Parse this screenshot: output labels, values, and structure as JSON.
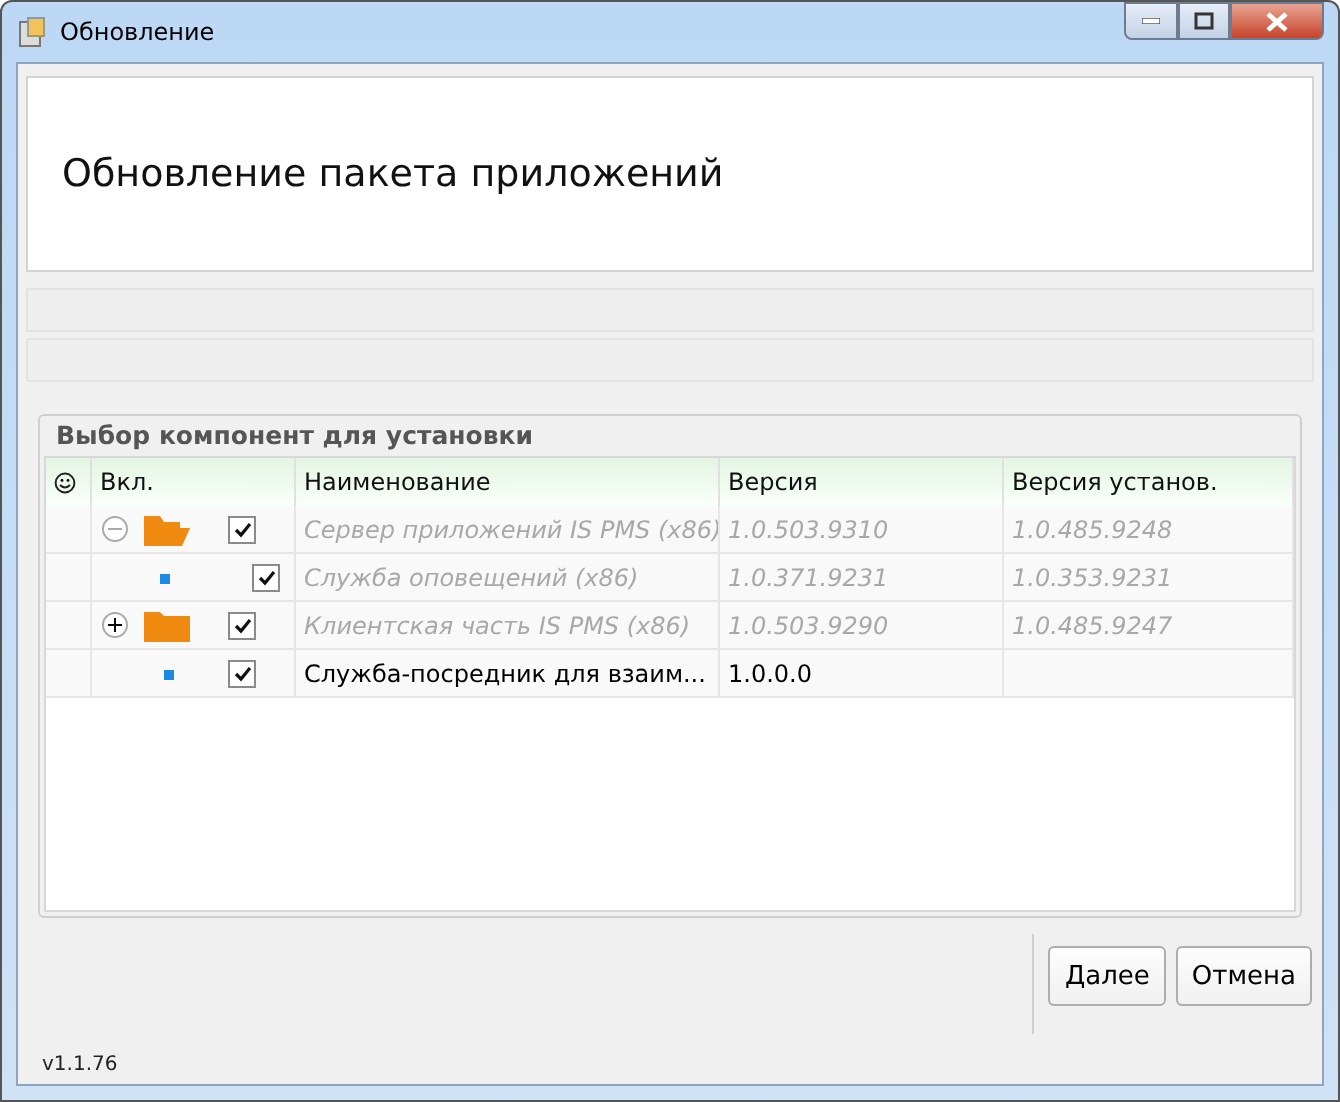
{
  "window": {
    "title": "Обновление"
  },
  "header": {
    "title": "Обновление пакета приложений"
  },
  "components": {
    "title": "Выбор компонент для установки",
    "columns": [
      "Вкл.",
      "Наименование",
      "Версия",
      "Версия установ."
    ],
    "rows": [
      {
        "kind": "folder",
        "expanded": true,
        "checked": true,
        "disabled": true,
        "name": "Сервер приложений IS PMS (x86)",
        "version": "1.0.503.9310",
        "installed": "1.0.485.9248",
        "children": [
          {
            "kind": "leaf",
            "checked": true,
            "disabled": true,
            "name": "Служба оповещений (x86)",
            "version": "1.0.371.9231",
            "installed": "1.0.353.9231"
          }
        ]
      },
      {
        "kind": "folder",
        "expanded": false,
        "checked": true,
        "disabled": true,
        "name": "Клиентская часть IS PMS (x86)",
        "version": "1.0.503.9290",
        "installed": "1.0.485.9247"
      },
      {
        "kind": "leaf",
        "checked": true,
        "disabled": false,
        "name": "Служба-посредник для взаим...",
        "version": "1.0.0.0"
      }
    ]
  },
  "buttons": [
    "Далее",
    "Отмена"
  ],
  "version": "v1.1.76"
}
